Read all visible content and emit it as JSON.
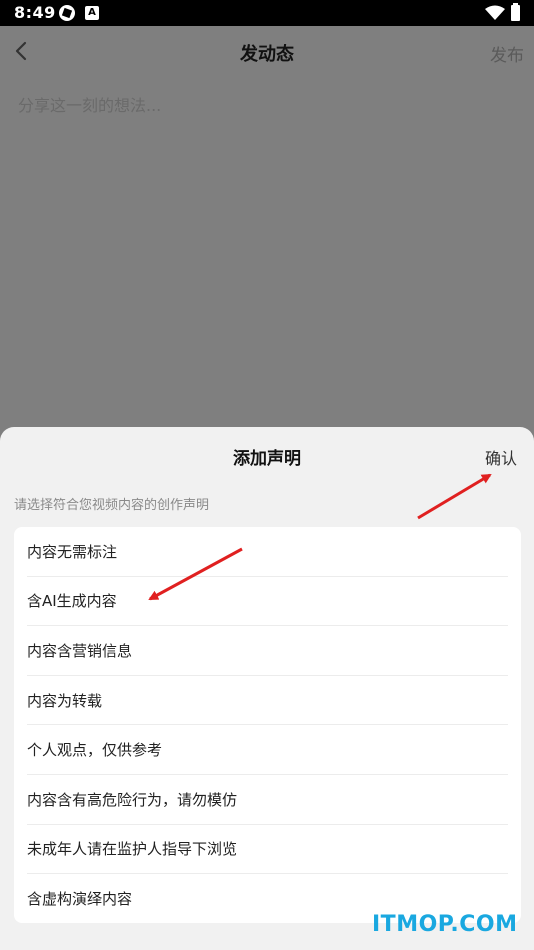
{
  "status_bar": {
    "time": "8:49",
    "icons_left": [
      "aperture-icon",
      "a-badge-icon"
    ],
    "icons_right": [
      "wifi-icon",
      "battery-icon"
    ]
  },
  "header": {
    "back_icon": "chevron-left-icon",
    "title": "发动态",
    "publish_label": "发布"
  },
  "composer": {
    "placeholder": "分享这一刻的想法..."
  },
  "sheet": {
    "title": "添加声明",
    "confirm_label": "确认",
    "hint": "请选择符合您视频内容的创作声明",
    "options": [
      "内容无需标注",
      "含AI生成内容",
      "内容含营销信息",
      "内容为转载",
      "个人观点，仅供参考",
      "内容含有高危险行为，请勿模仿",
      "未成年人请在监护人指导下浏览",
      "含虚构演绎内容"
    ]
  },
  "annotation_color": "#e02020",
  "watermark": "ITMOP.COM"
}
